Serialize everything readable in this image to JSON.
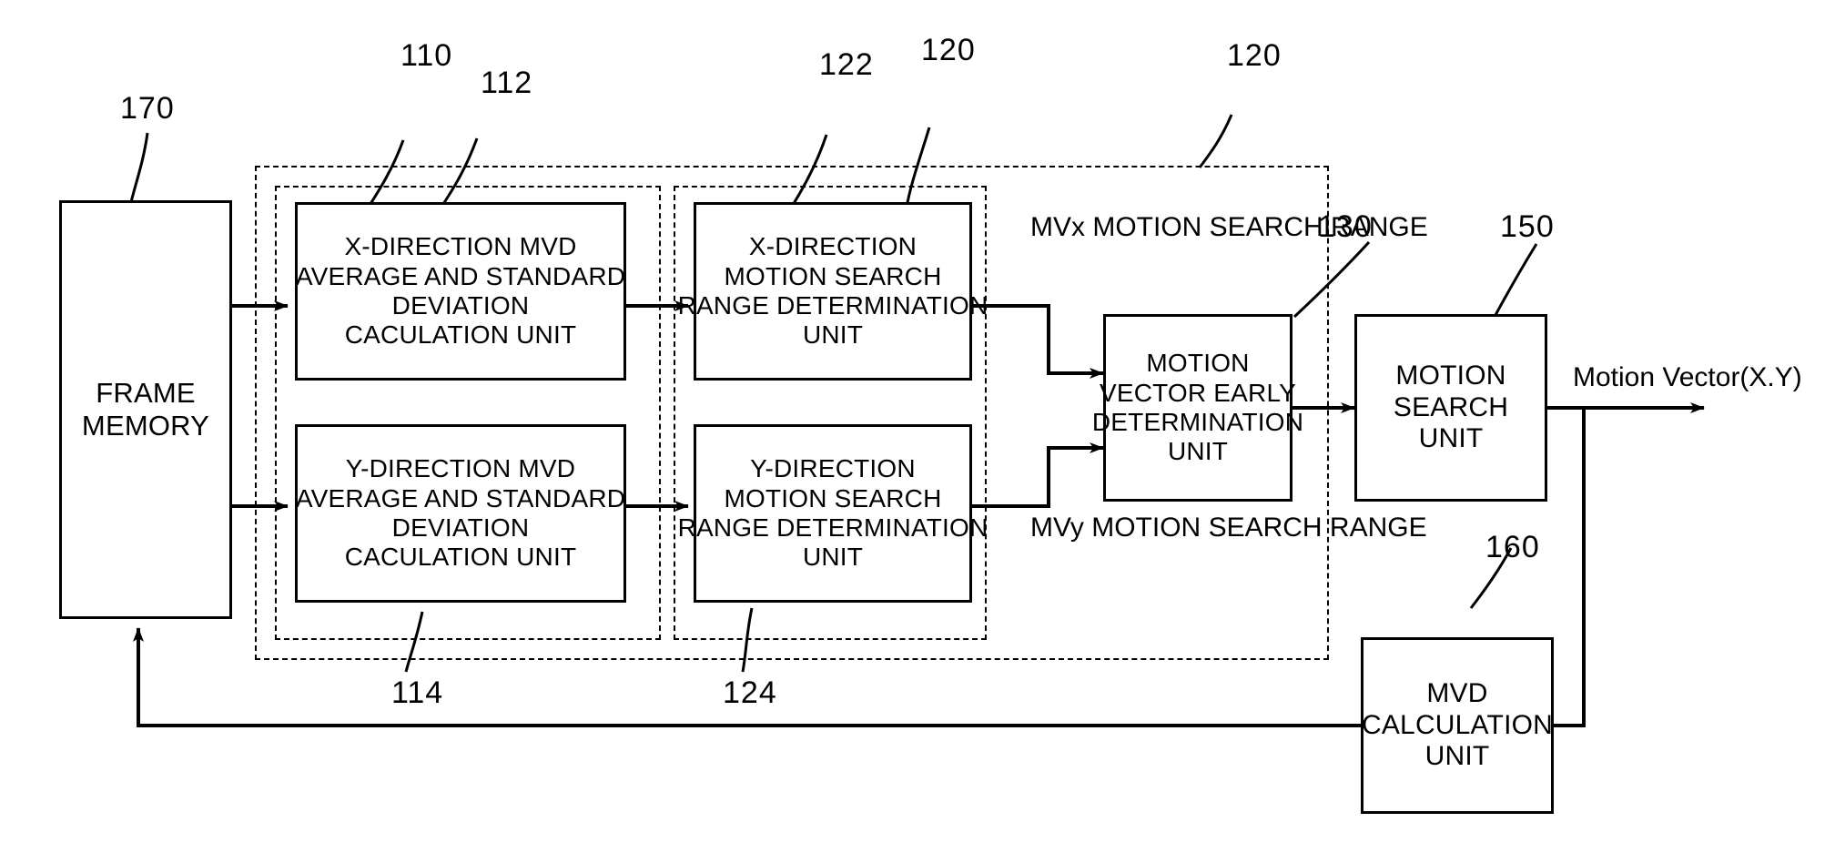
{
  "diagram": {
    "blocks": {
      "frame_memory": {
        "lines": [
          "FRAME",
          "MEMORY"
        ],
        "ref": "170"
      },
      "x_mvd": {
        "lines": [
          "X-DIRECTION MVD",
          "AVERAGE AND STANDARD",
          "DEVIATION",
          "CACULATION UNIT"
        ],
        "ref": "112"
      },
      "y_mvd": {
        "lines": [
          "Y-DIRECTION MVD",
          "AVERAGE AND STANDARD",
          "DEVIATION",
          "CACULATION UNIT"
        ],
        "ref": "114"
      },
      "x_range": {
        "lines": [
          "X-DIRECTION",
          "MOTION SEARCH",
          "RANGE DETERMINATION",
          "UNIT"
        ],
        "ref": "122"
      },
      "y_range": {
        "lines": [
          "Y-DIRECTION",
          "MOTION SEARCH",
          "RANGE DETERMINATION",
          "UNIT"
        ],
        "ref": "124"
      },
      "mv_early": {
        "lines": [
          "MOTION",
          "VECTOR EARLY",
          "DETERMINATION",
          "UNIT"
        ],
        "ref": "130"
      },
      "motion_search": {
        "lines": [
          "MOTION",
          "SEARCH",
          "UNIT"
        ],
        "ref": "150"
      },
      "mvd_calc": {
        "lines": [
          "MVD",
          "CALCULATION",
          "UNIT"
        ],
        "ref": "160"
      }
    },
    "annotations": {
      "mvx_range": [
        "MVx MOTION",
        "SEARCH RANGE"
      ],
      "mvy_range": [
        "MVy MOTION",
        "SEARCH RANGE"
      ],
      "output_label": "Motion Vector(X.Y)"
    },
    "reference_numerals": {
      "frame_memory": "170",
      "mvd_group": "110",
      "x_mvd": "112",
      "y_mvd": "114",
      "x_range": "122",
      "y_range": "124",
      "range_group": "120",
      "outer_group": "120",
      "mv_early": "130",
      "motion_search": "150",
      "mvd_calc": "160"
    },
    "colors": {
      "ink": "#000000",
      "paper": "#ffffff"
    }
  }
}
